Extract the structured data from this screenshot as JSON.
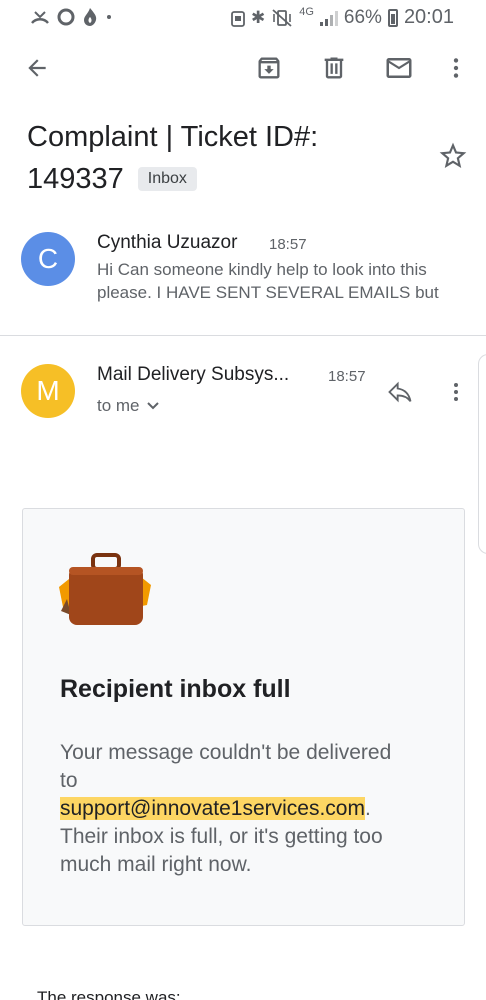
{
  "status_bar": {
    "left_icons": [
      "missed-call-icon",
      "sync-icon",
      "flame-icon",
      "dot-icon"
    ],
    "network": "4G",
    "battery_pct": "66%",
    "time": "20:01"
  },
  "toolbar": {
    "back": "back-arrow-icon",
    "archive": "archive-icon",
    "delete": "trash-icon",
    "mark_unread": "mail-icon",
    "more": "more-vert-icon"
  },
  "subject": {
    "line1": "Complaint | Ticket ID#:",
    "line2": "149337",
    "label": "Inbox"
  },
  "messages": [
    {
      "initial": "C",
      "sender": "Cynthia Uzuazor",
      "time": "18:57",
      "snippet_line1": "Hi Can someone kindly help to look into this",
      "snippet_line2": "please. I HAVE SENT SEVERAL EMAILS but"
    },
    {
      "initial": "M",
      "sender": "Mail Delivery Subsys...",
      "time": "18:57",
      "to": "to me"
    }
  ],
  "bounce": {
    "title": "Recipient inbox full",
    "line1": "Your message couldn't be delivered",
    "line2": "to",
    "address": "support@innovate1services.com",
    "address_suffix": ".",
    "line3": "Their inbox is full, or it's getting too",
    "line4": "much mail right now."
  },
  "response_text": "The response was:",
  "colors": {
    "avatar_c": "#5b8ee6",
    "avatar_m": "#f6bf26",
    "highlight": "#fdd663",
    "suitcase": "#a0461a"
  }
}
